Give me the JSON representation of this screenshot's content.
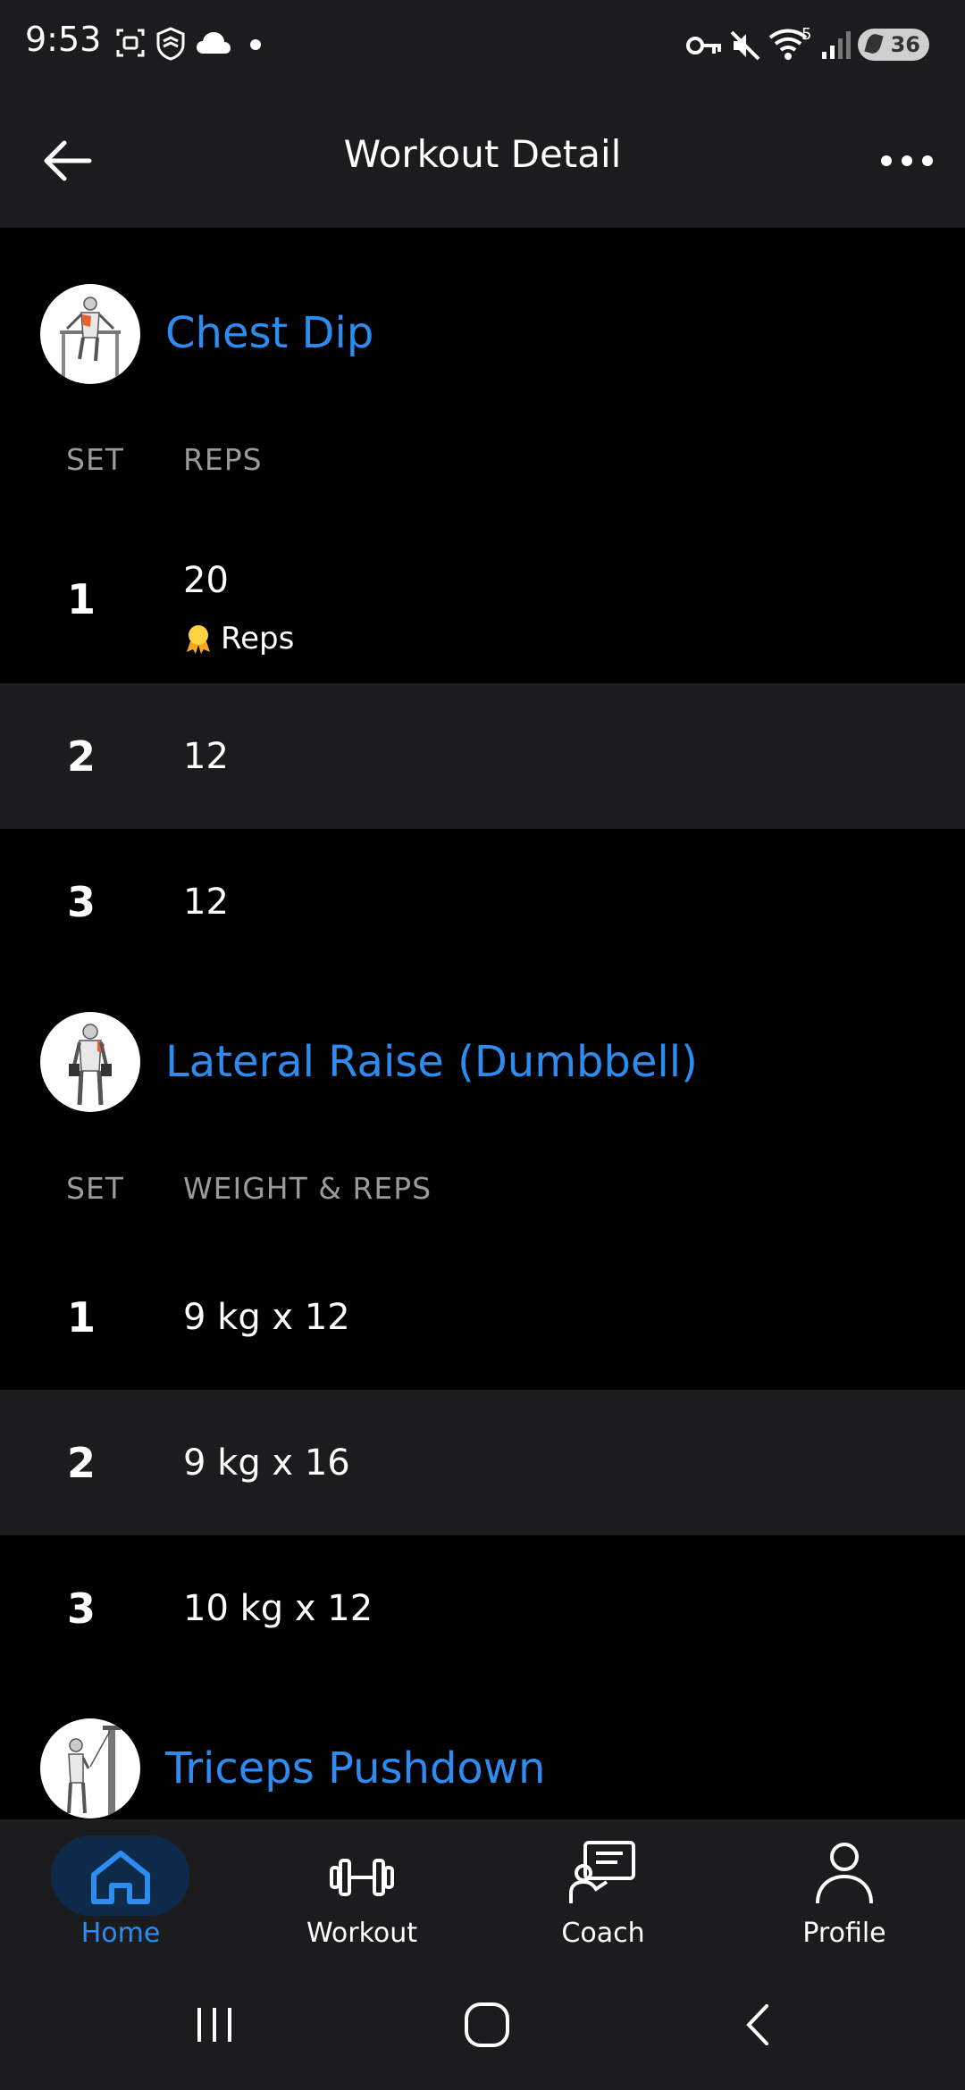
{
  "status_bar": {
    "time": "9:53",
    "battery": "36",
    "network_badge": "5"
  },
  "header": {
    "title": "Workout Detail"
  },
  "exercises": [
    {
      "name": "Chest Dip",
      "col_set": "SET",
      "col_value": "REPS",
      "sets": [
        {
          "set": "1",
          "value": "20",
          "badge": "Reps"
        },
        {
          "set": "2",
          "value": "12"
        },
        {
          "set": "3",
          "value": "12"
        }
      ]
    },
    {
      "name": "Lateral Raise (Dumbbell)",
      "col_set": "SET",
      "col_value": "WEIGHT & REPS",
      "sets": [
        {
          "set": "1",
          "value": "9 kg x 12"
        },
        {
          "set": "2",
          "value": "9 kg x 16"
        },
        {
          "set": "3",
          "value": "10 kg x 12"
        }
      ]
    },
    {
      "name": "Triceps Pushdown"
    }
  ],
  "bottom_nav": {
    "items": [
      {
        "label": "Home",
        "icon": "home-icon",
        "active": true
      },
      {
        "label": "Workout",
        "icon": "dumbbell-icon",
        "active": false
      },
      {
        "label": "Coach",
        "icon": "coach-icon",
        "active": false
      },
      {
        "label": "Profile",
        "icon": "profile-icon",
        "active": false
      }
    ]
  },
  "colors": {
    "accent": "#2d8cf0",
    "surface": "#1c1c1e",
    "background": "#000000"
  }
}
